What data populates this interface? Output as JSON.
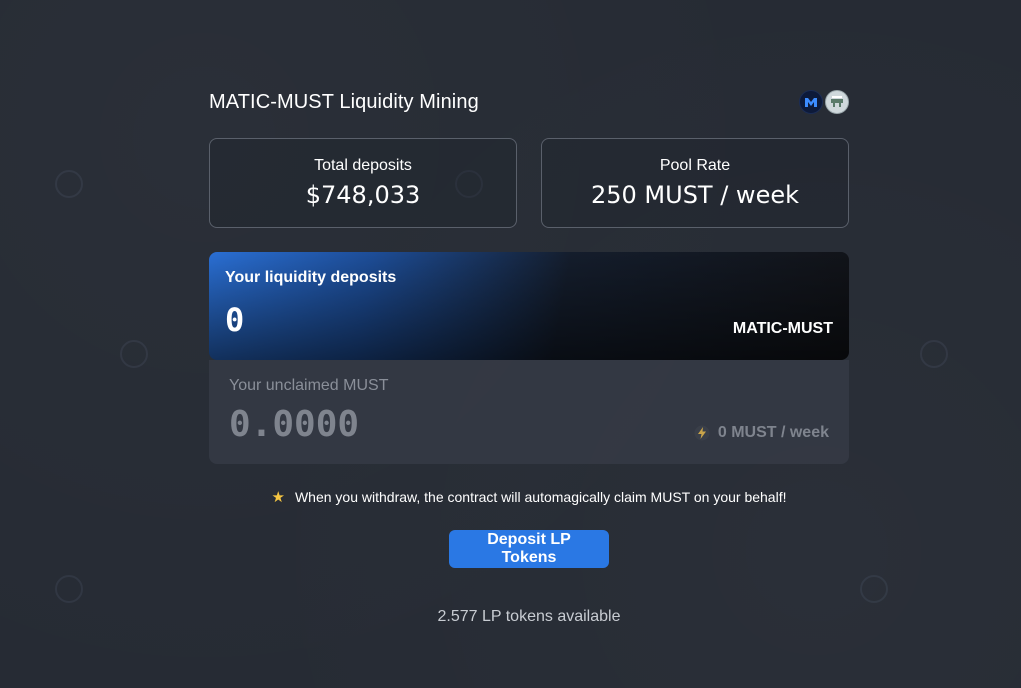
{
  "header": {
    "title": "MATIC-MUST Liquidity Mining",
    "token_icons": [
      "matic-token-icon",
      "must-token-icon"
    ]
  },
  "stats": {
    "total_deposits_label": "Total deposits",
    "total_deposits_value": "$748,033",
    "pool_rate_label": "Pool Rate",
    "pool_rate_value": "250 MUST / week"
  },
  "deposit": {
    "label": "Your liquidity deposits",
    "value": "0",
    "pair": "MATIC-MUST"
  },
  "unclaimed": {
    "label": "Your unclaimed MUST",
    "value": "0.0000",
    "rate": "0 MUST / week"
  },
  "notice": {
    "text": "When you withdraw, the contract will automagically claim MUST on your behalf!"
  },
  "actions": {
    "deposit_button_label": "Deposit LP Tokens"
  },
  "balance": {
    "available_text": "2.577 LP tokens available"
  },
  "colors": {
    "background": "#262b34",
    "accent": "#2a78e4",
    "star": "#f5c542",
    "muted_text": "#7f848e"
  }
}
